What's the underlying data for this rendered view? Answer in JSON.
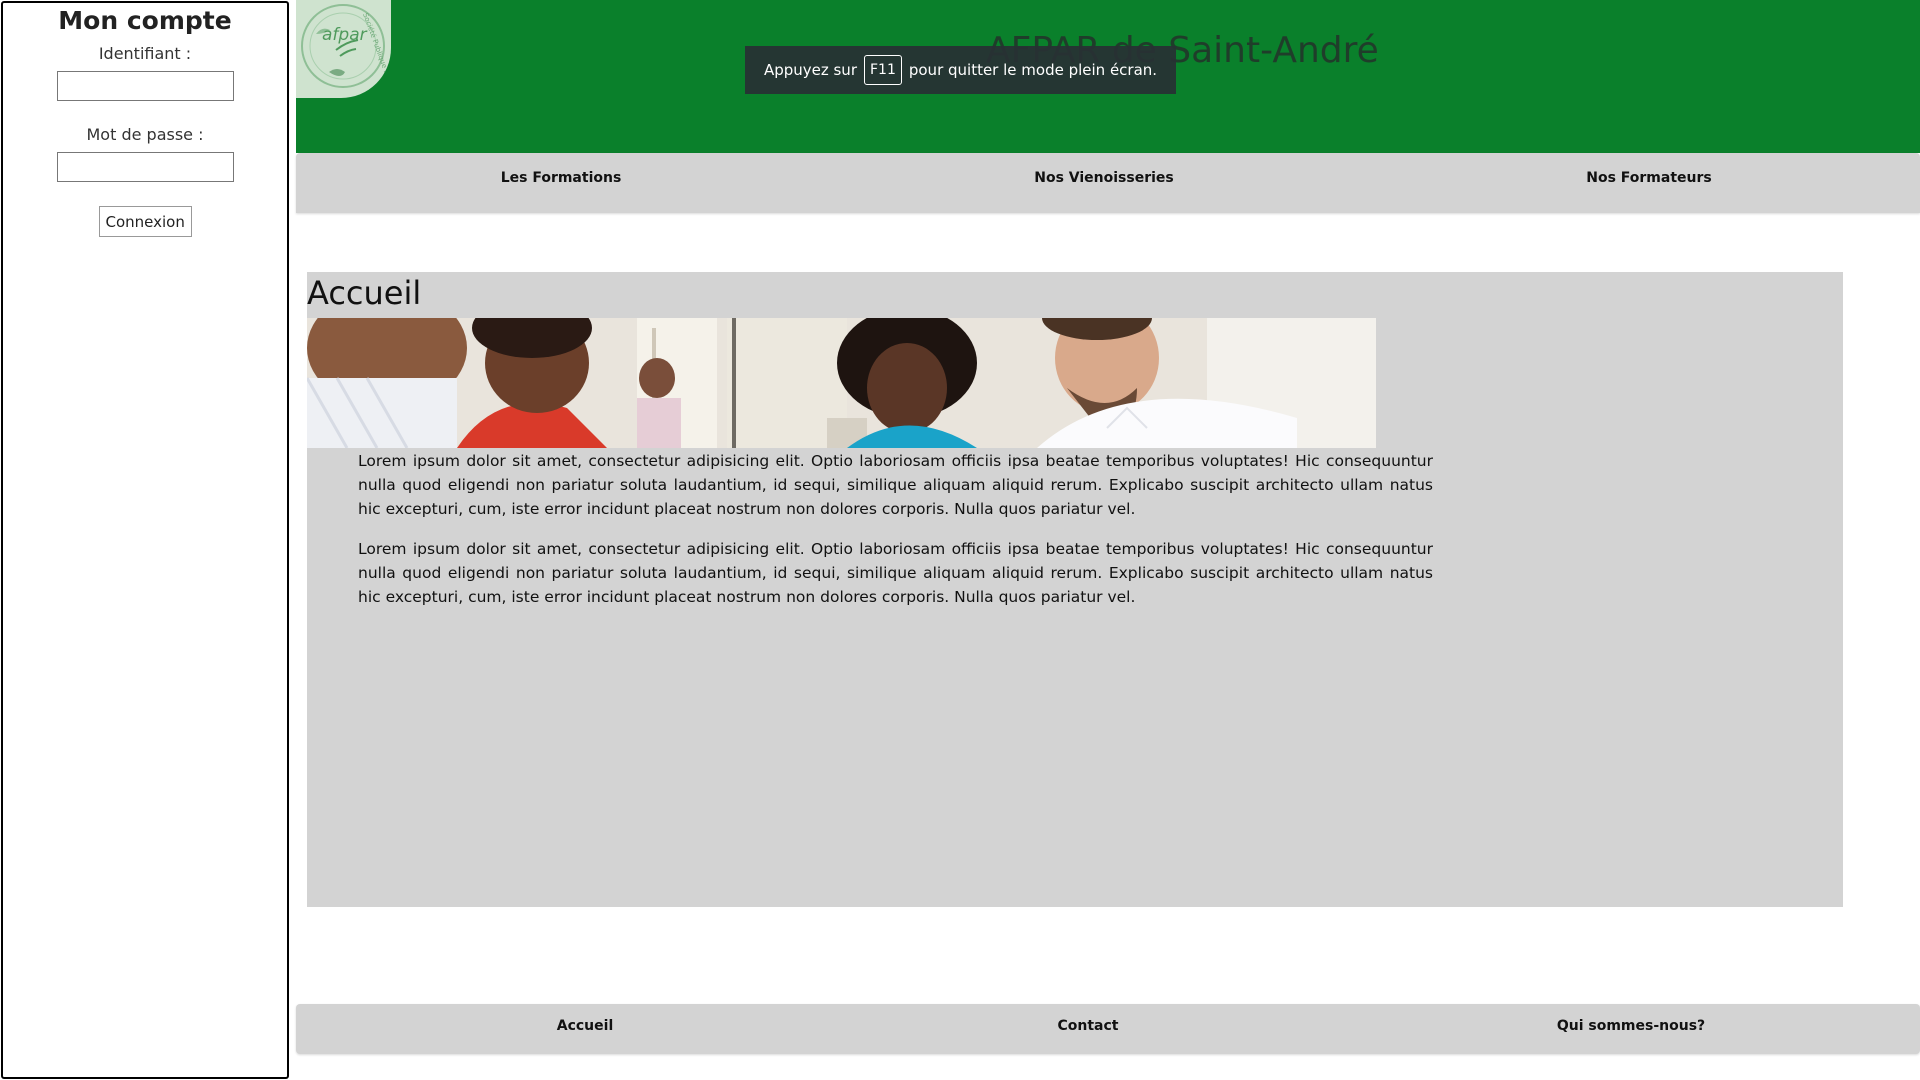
{
  "sidebar": {
    "title": "Mon compte",
    "identifiant_label": "Identifiant :",
    "identifiant_value": "",
    "password_label": "Mot de passe :",
    "password_value": "",
    "login_button": "Connexion"
  },
  "header": {
    "logo_text": "afpar",
    "logo_ring_text": "Société Publique Locale",
    "site_title": "AFPAR de Saint-André"
  },
  "fullscreen_notice": {
    "before": "Appuyez sur",
    "key": "F11",
    "after": "pour quitter le mode plein écran."
  },
  "topnav": {
    "items": [
      {
        "label": "Les Formations"
      },
      {
        "label": "Nos Vienoisseries"
      },
      {
        "label": "Nos Formateurs"
      }
    ]
  },
  "main": {
    "heading": "Accueil",
    "paragraphs": [
      "Lorem ipsum dolor sit amet, consectetur adipisicing elit. Optio laboriosam officiis ipsa beatae temporibus voluptates! Hic consequuntur nulla quod eligendi non pariatur soluta laudantium, id sequi, similique aliquam aliquid rerum. Explicabo suscipit architecto ullam natus hic excepturi, cum, iste error incidunt placeat nostrum non dolores corporis. Nulla quos pariatur vel.",
      "Lorem ipsum dolor sit amet, consectetur adipisicing elit. Optio laboriosam officiis ipsa beatae temporibus voluptates! Hic consequuntur nulla quod eligendi non pariatur soluta laudantium, id sequi, similique aliquam aliquid rerum. Explicabo suscipit architecto ullam natus hic excepturi, cum, iste error incidunt placeat nostrum non dolores corporis. Nulla quos pariatur vel."
    ]
  },
  "footer": {
    "items": [
      {
        "label": "Accueil"
      },
      {
        "label": "Contact"
      },
      {
        "label": "Qui sommes-nous?"
      }
    ]
  },
  "colors": {
    "header_green": "#0a802b",
    "nav_gray": "#d3d3d3",
    "content_gray": "#d3d3d3"
  }
}
